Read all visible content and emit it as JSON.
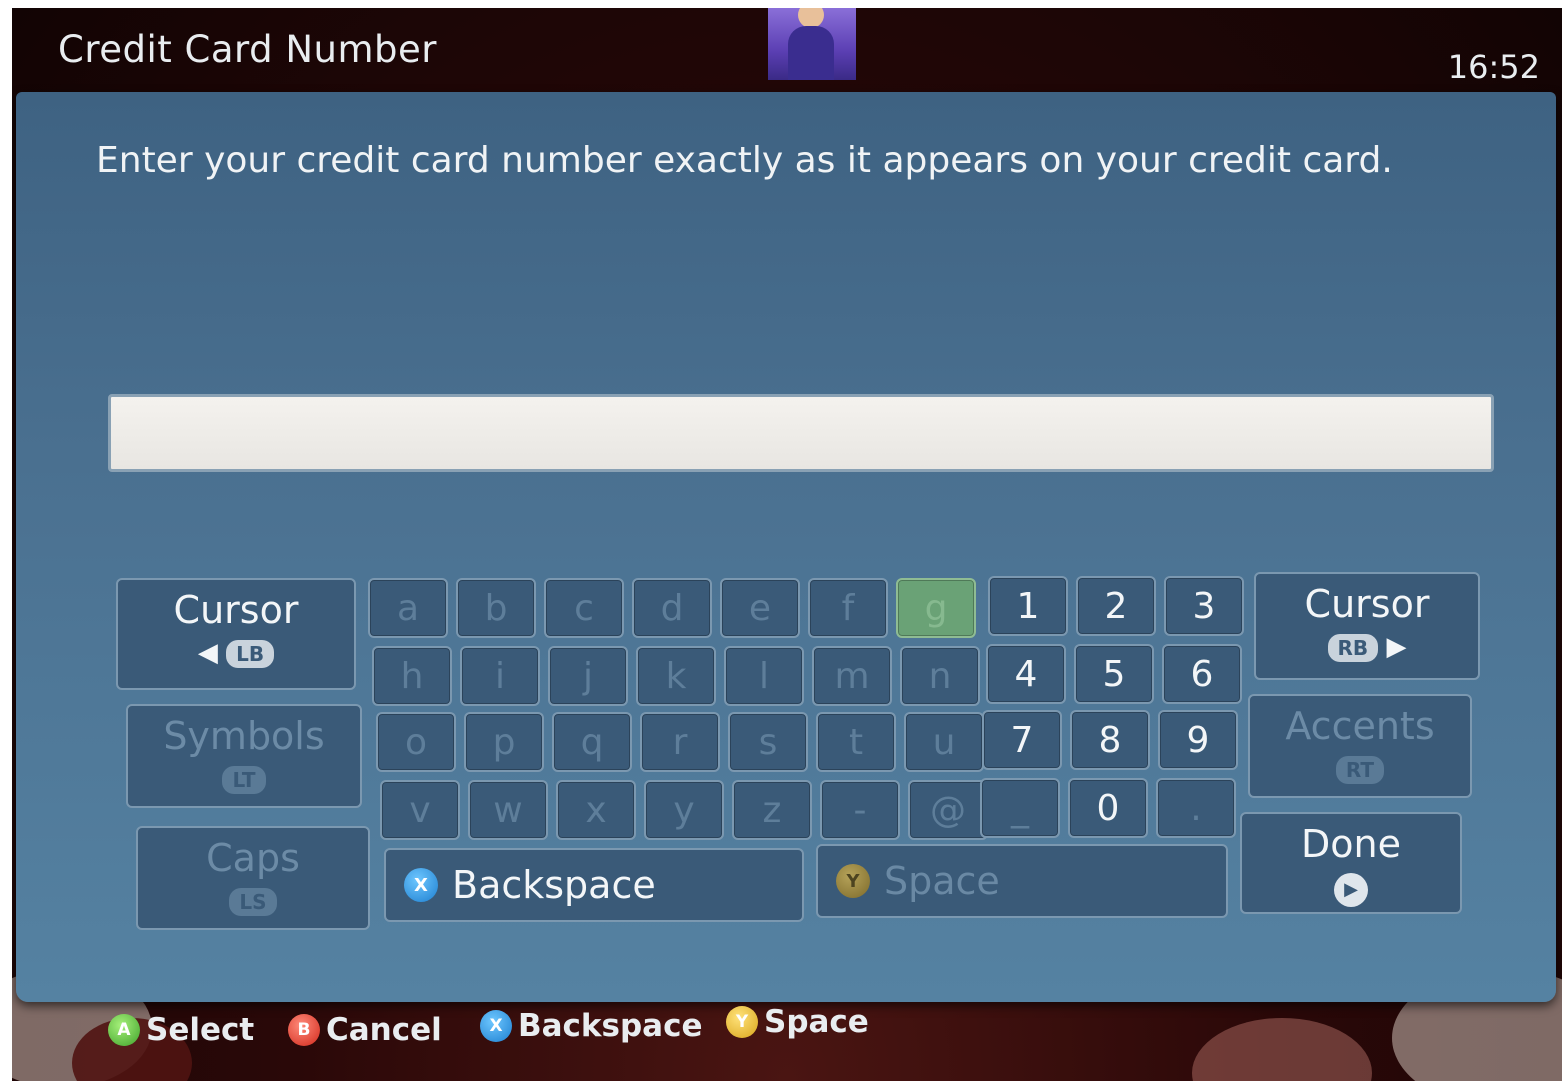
{
  "header": {
    "title": "Credit Card Number",
    "clock": "16:52"
  },
  "dialog": {
    "instructions": "Enter your credit card number exactly as it appears on your credit card.",
    "input_value": ""
  },
  "keyboard": {
    "cursor_left": {
      "label": "Cursor",
      "button": "LB",
      "arrow": "◀"
    },
    "cursor_right": {
      "label": "Cursor",
      "button": "RB",
      "arrow": "▶"
    },
    "symbols": {
      "label": "Symbols",
      "button": "LT"
    },
    "accents": {
      "label": "Accents",
      "button": "RT"
    },
    "caps": {
      "label": "Caps",
      "button": "LS"
    },
    "done": {
      "label": "Done",
      "icon": "▶"
    },
    "letter_rows": [
      [
        "a",
        "b",
        "c",
        "d",
        "e",
        "f",
        "g"
      ],
      [
        "h",
        "i",
        "j",
        "k",
        "l",
        "m",
        "n"
      ],
      [
        "o",
        "p",
        "q",
        "r",
        "s",
        "t",
        "u"
      ],
      [
        "v",
        "w",
        "x",
        "y",
        "z",
        "-",
        "@"
      ]
    ],
    "highlighted_key": "g",
    "digit_rows": [
      [
        "1",
        "2",
        "3"
      ],
      [
        "4",
        "5",
        "6"
      ],
      [
        "7",
        "8",
        "9"
      ],
      [
        "_",
        "0",
        "."
      ]
    ],
    "backspace": {
      "label": "Backspace",
      "button": "X"
    },
    "space": {
      "label": "Space",
      "button": "Y"
    }
  },
  "footer": {
    "select": {
      "button": "A",
      "label": "Select"
    },
    "cancel": {
      "button": "B",
      "label": "Cancel"
    },
    "backspace": {
      "button": "X",
      "label": "Backspace"
    },
    "space": {
      "button": "Y",
      "label": "Space"
    }
  }
}
